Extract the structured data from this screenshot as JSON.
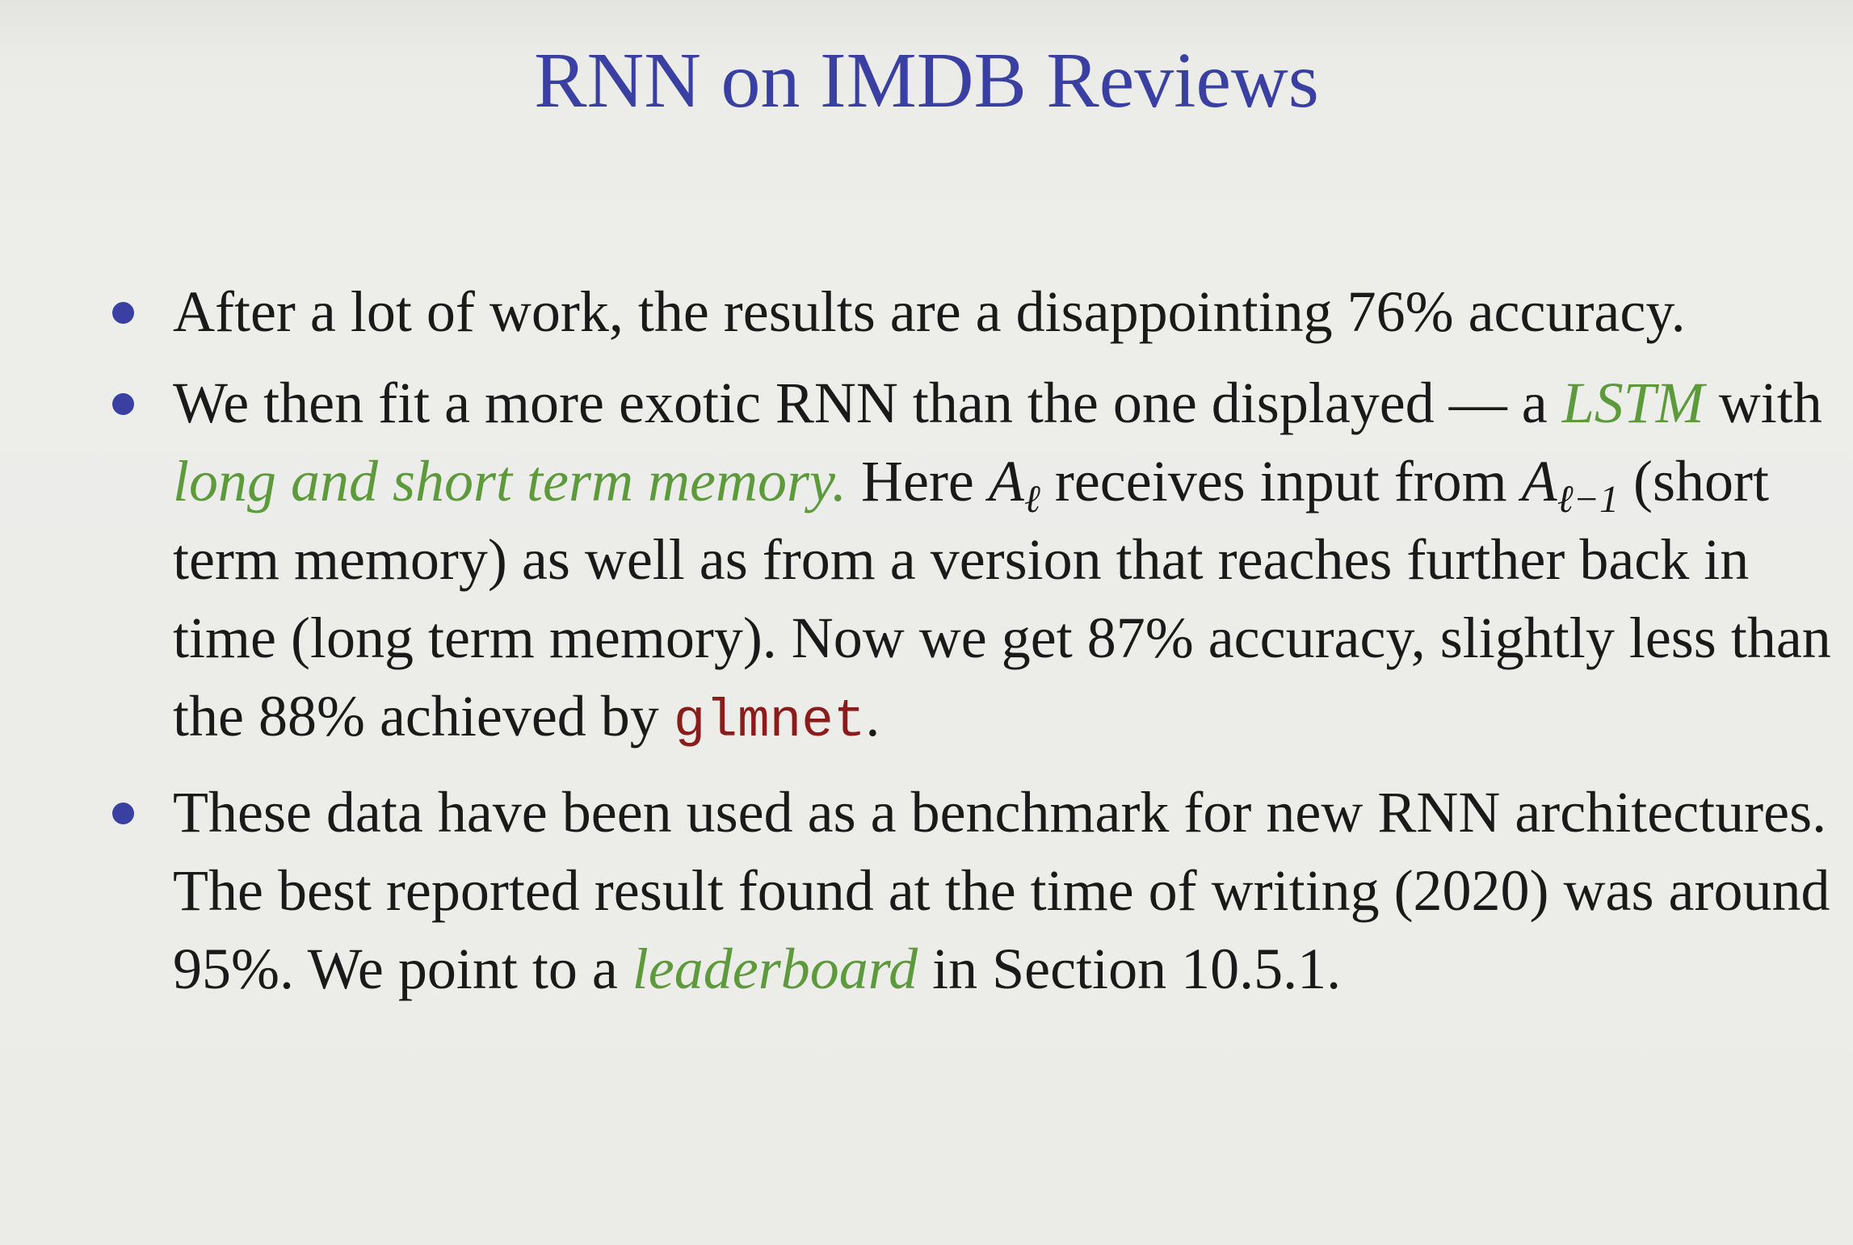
{
  "slide": {
    "title": "RNN on IMDB Reviews",
    "bullets": [
      {
        "text": "After a lot of work, the results are a disappointing 76% accuracy."
      },
      {
        "t1": "We then fit a more exotic RNN than the one displayed — a ",
        "lstm": "LSTM",
        "t2": " with ",
        "memory": "long and short term memory.",
        "t3": " Here ",
        "A_sym": "A",
        "sub_l": "ℓ",
        "t4": " receives input from ",
        "A_sym2": "A",
        "sub_l1": "ℓ−1",
        "t5": " (short term memory) as well as from a version that reaches further back in time (long term memory). Now we get 87% accuracy, slightly less than the 88% achieved by ",
        "code": "glmnet",
        "t6": "."
      },
      {
        "t1": "These data have been used as a benchmark for new RNN architectures. The best reported result found at the time of writing (2020) was around 95%. We point to a ",
        "leaderboard": "leaderboard",
        "t2": " in Section 10.5.1."
      }
    ]
  },
  "colors": {
    "title": "#3a3fa2",
    "bullet_dot": "#3a3fa2",
    "highlight_green": "#5d9a3c",
    "code_red": "#8a1c1c",
    "background": "#ecece7"
  }
}
